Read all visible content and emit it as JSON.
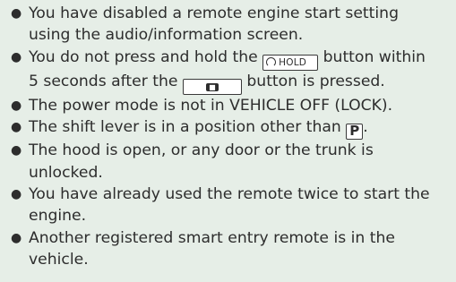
{
  "conditions": [
    {
      "text": "You have disabled a remote engine start setting using the audio/information screen."
    },
    {
      "before": "You do not press and hold the",
      "hold_button_label": "HOLD",
      "middle": "button within 5 seconds after the",
      "after": "button is pressed."
    },
    {
      "text": "The power mode is not in VEHICLE OFF (LOCK)."
    },
    {
      "before": "The shift lever is in a position other than",
      "park_key_label": "P",
      "after": "."
    },
    {
      "text": "The hood is open, or any door or the trunk is unlocked."
    },
    {
      "text": "You have already used the remote twice to start the engine."
    },
    {
      "text": "Another registered smart entry remote is in the vehicle."
    }
  ],
  "icons": {
    "hold_button": "remote-start-hold-icon",
    "lock_button": "lock-button-icon",
    "park_key": "park-key-icon"
  }
}
